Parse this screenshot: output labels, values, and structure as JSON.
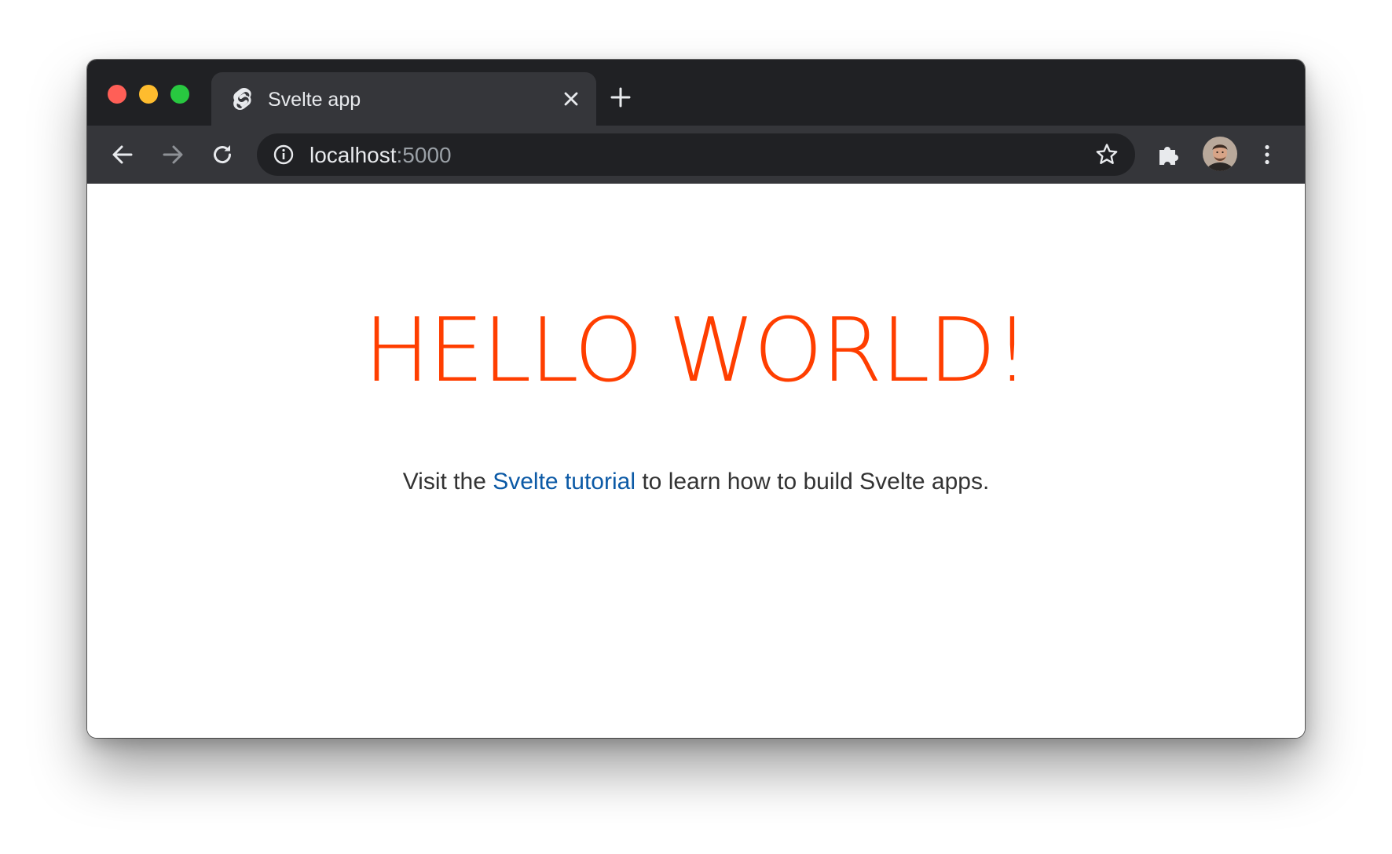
{
  "browser": {
    "tab": {
      "title": "Svelte app",
      "favicon": "svelte-logo-icon"
    },
    "omnibox": {
      "host": "localhost",
      "port": ":5000"
    },
    "icons": {
      "close": "close-icon",
      "new_tab": "plus-icon",
      "back": "arrow-left-icon",
      "forward": "arrow-right-icon",
      "reload": "reload-icon",
      "info": "info-icon",
      "bookmark": "star-icon",
      "extensions": "puzzle-icon",
      "menu": "kebab-menu-icon"
    },
    "colors": {
      "traffic_close": "#ff5f57",
      "traffic_min": "#febc2e",
      "traffic_max": "#28c840",
      "chrome_dark": "#202124",
      "chrome_toolbar": "#35363a",
      "accent": "#ff3e00",
      "link": "#0c5aa6"
    }
  },
  "page": {
    "heading": "HELLO WORLD!",
    "paragraph": {
      "before": "Visit the ",
      "link_text": "Svelte tutorial",
      "after": " to learn how to build Svelte apps."
    }
  }
}
